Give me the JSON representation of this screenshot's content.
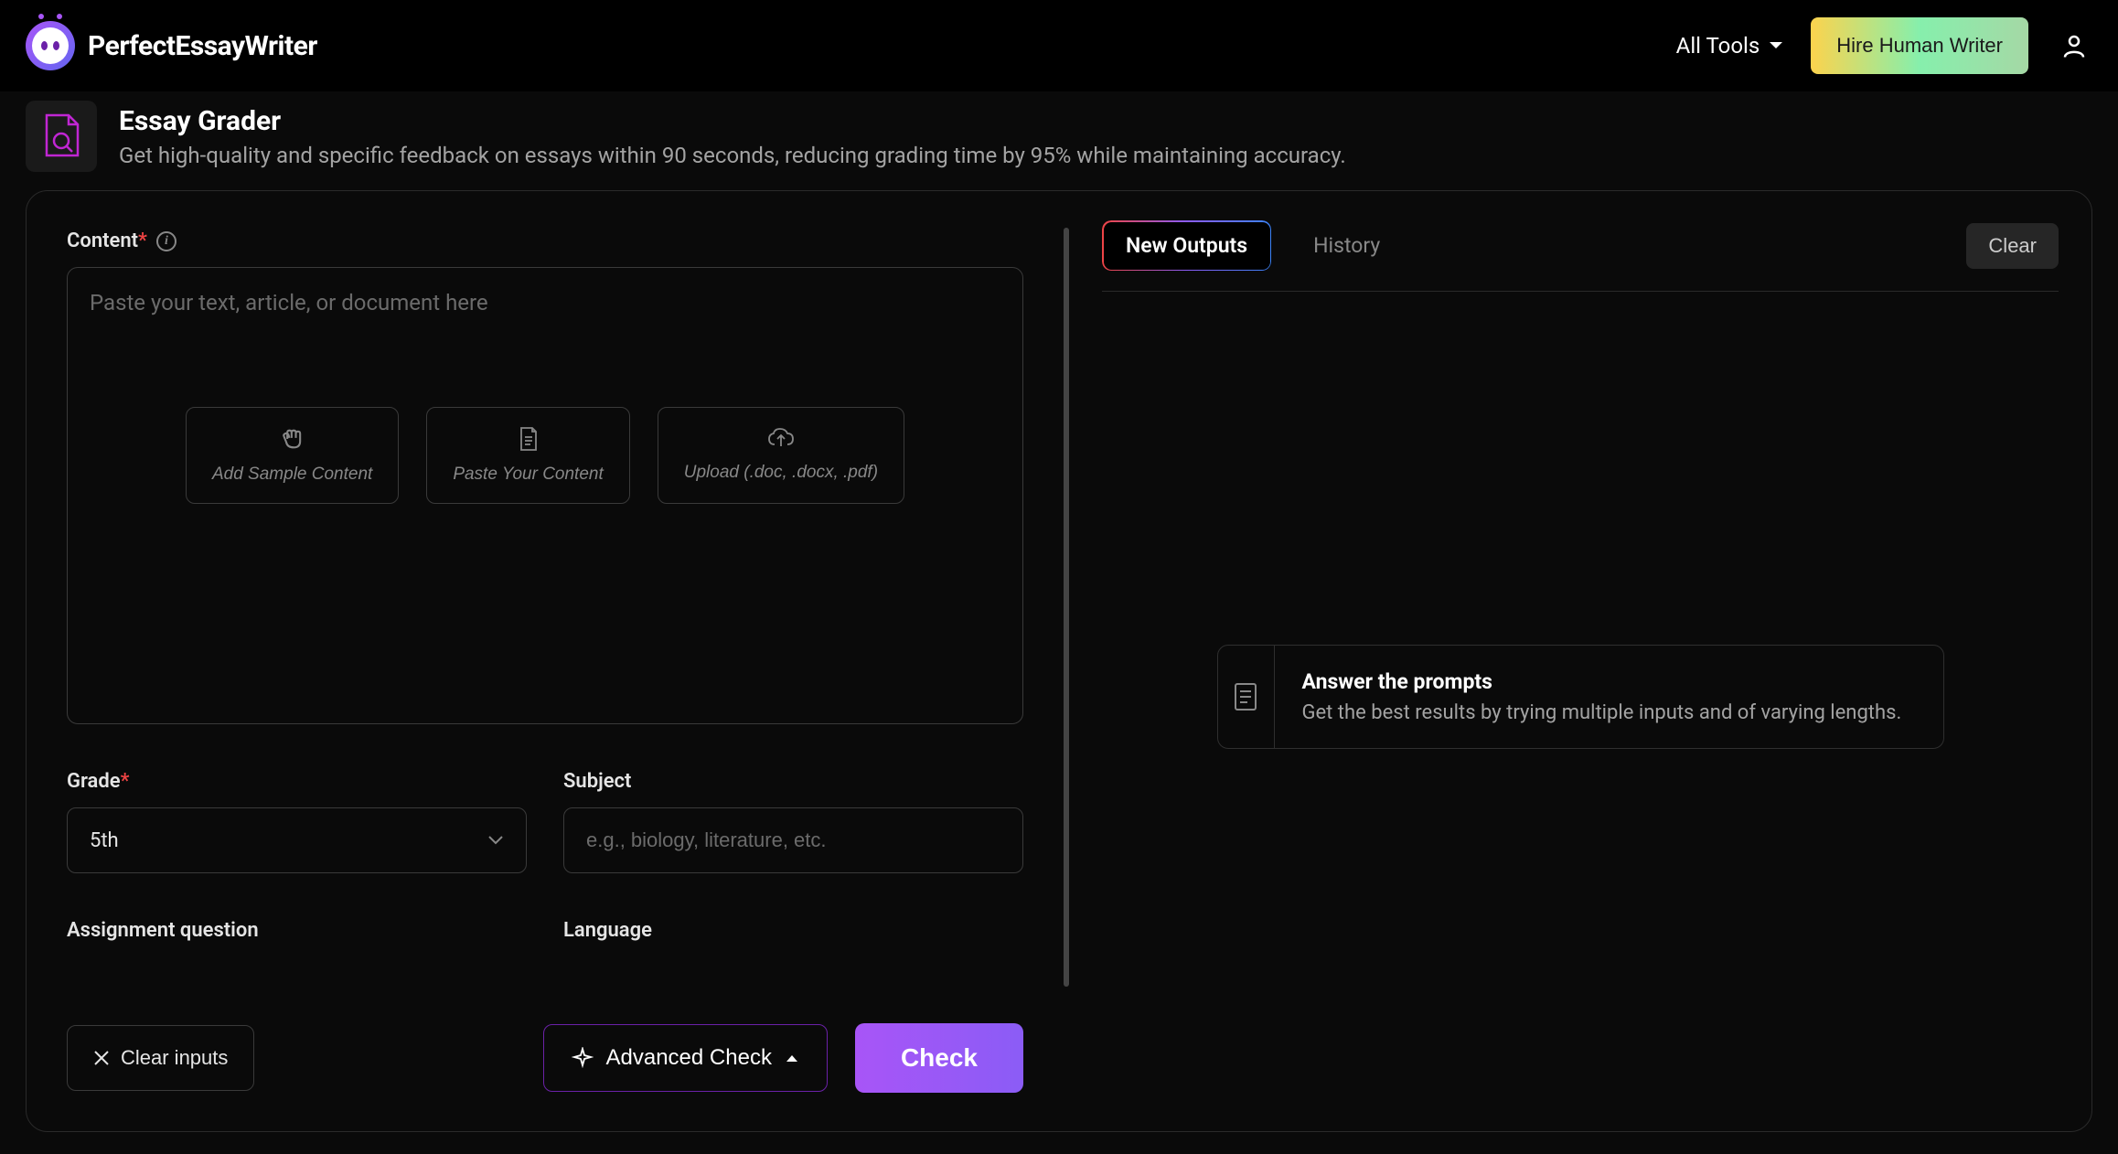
{
  "header": {
    "logo_text": "PerfectEssayWriter",
    "all_tools": "All Tools",
    "hire_button": "Hire Human Writer"
  },
  "page": {
    "title": "Essay Grader",
    "subtitle": "Get high-quality and specific feedback on essays within 90 seconds, reducing grading time by 95% while maintaining accuracy."
  },
  "form": {
    "content_label": "Content",
    "content_placeholder": "Paste your text, article, or document here",
    "sample_btn": "Add Sample Content",
    "paste_btn": "Paste Your Content",
    "upload_btn": "Upload (.doc, .docx, .pdf)",
    "grade_label": "Grade",
    "grade_value": "5th",
    "subject_label": "Subject",
    "subject_placeholder": "e.g., biology, literature, etc.",
    "assignment_label": "Assignment question",
    "language_label": "Language",
    "clear_inputs": "Clear inputs",
    "advanced_check": "Advanced Check",
    "check": "Check"
  },
  "output": {
    "tab_new": "New Outputs",
    "tab_history": "History",
    "clear": "Clear",
    "prompt_title": "Answer the prompts",
    "prompt_sub": "Get the best results by trying multiple inputs and of varying lengths."
  }
}
